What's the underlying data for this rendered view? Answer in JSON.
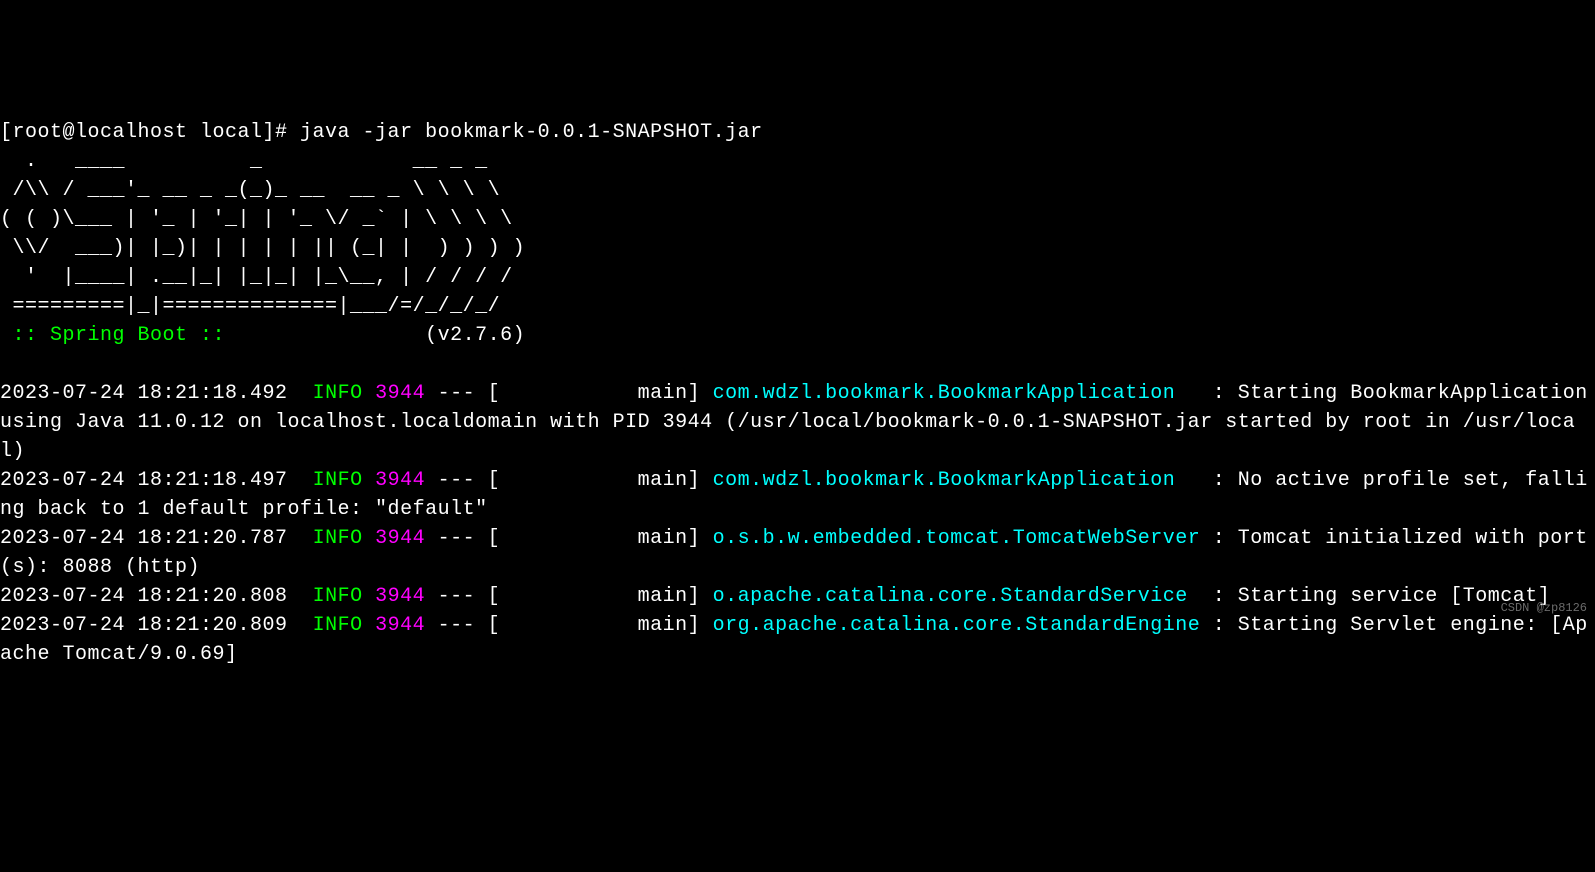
{
  "prompt": {
    "user_host": "[root@localhost local]# ",
    "command": "java -jar bookmark-0.0.1-SNAPSHOT.jar"
  },
  "banner": {
    "ascii": "  .   ____          _            __ _ _\n /\\\\ / ___'_ __ _ _(_)_ __  __ _ \\ \\ \\ \\\n( ( )\\___ | '_ | '_| | '_ \\/ _` | \\ \\ \\ \\\n \\\\/  ___)| |_)| | | | | || (_| |  ) ) ) )\n  '  |____| .__|_| |_|_| |_\\__, | / / / /\n =========|_|==============|___/=/_/_/_/",
    "label": " :: Spring Boot :: ",
    "version_pad": "               ",
    "version": "(v2.7.6)"
  },
  "logs": [
    {
      "ts": "2023-07-24 18:21:18.492",
      "level": "INFO",
      "pid": "3944",
      "sep": " --- [           main] ",
      "logger": "com.wdzl.bookmark.BookmarkApplication",
      "pad": "   ",
      "msg": ": Starting BookmarkApplication using Java 11.0.12 on localhost.localdomain with PID 3944 (/usr/local/bookmark-0.0.1-SNAPSHOT.jar started by root in /usr/local)"
    },
    {
      "ts": "2023-07-24 18:21:18.497",
      "level": "INFO",
      "pid": "3944",
      "sep": " --- [           main] ",
      "logger": "com.wdzl.bookmark.BookmarkApplication",
      "pad": "   ",
      "msg": ": No active profile set, falling back to 1 default profile: \"default\""
    },
    {
      "ts": "2023-07-24 18:21:20.787",
      "level": "INFO",
      "pid": "3944",
      "sep": " --- [           main] ",
      "logger": "o.s.b.w.embedded.tomcat.TomcatWebServer",
      "pad": " ",
      "msg": ": Tomcat initialized with port(s): 8088 (http)"
    },
    {
      "ts": "2023-07-24 18:21:20.808",
      "level": "INFO",
      "pid": "3944",
      "sep": " --- [           main] ",
      "logger": "o.apache.catalina.core.StandardService",
      "pad": "  ",
      "msg": ": Starting service [Tomcat]"
    },
    {
      "ts": "2023-07-24 18:21:20.809",
      "level": "INFO",
      "pid": "3944",
      "sep": " --- [           main] ",
      "logger": "org.apache.catalina.core.StandardEngine",
      "pad": " ",
      "msg": ": Starting Servlet engine: [Apache Tomcat/9.0.69]"
    }
  ],
  "watermark": "CSDN @zp8126"
}
